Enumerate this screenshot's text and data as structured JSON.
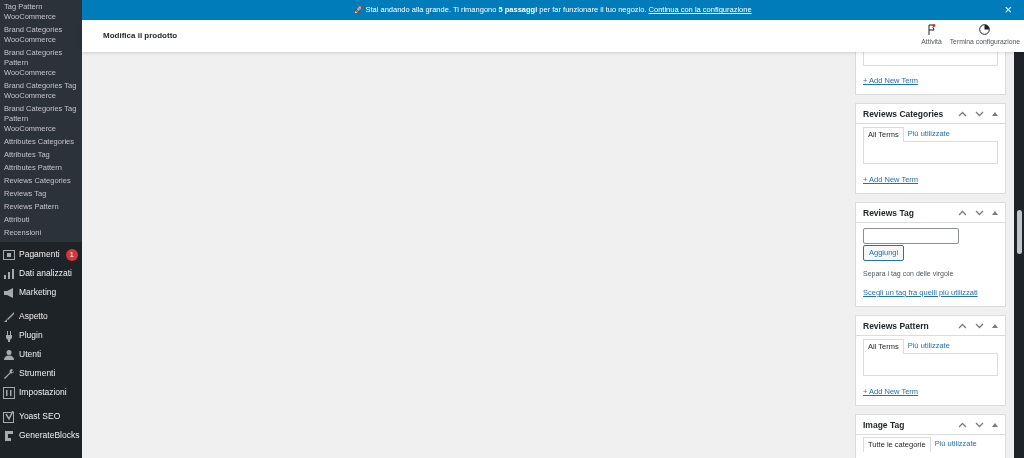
{
  "sidebar": {
    "submenu": [
      {
        "label": "Tag Pattern WooCommerce"
      },
      {
        "label": "Brand Categories WooCommerce"
      },
      {
        "label": "Brand Categories Pattern WooCommerce"
      },
      {
        "label": "Brand Categories Tag WooCommerce"
      },
      {
        "label": "Brand Categories Tag Pattern WooCommerce"
      },
      {
        "label": "Attributes Categories"
      },
      {
        "label": "Attributes Tag"
      },
      {
        "label": "Attributes Pattern"
      },
      {
        "label": "Reviews Categories"
      },
      {
        "label": "Reviews Tag"
      },
      {
        "label": "Reviews Pattern"
      },
      {
        "label": "Attributi"
      },
      {
        "label": "Recensioni"
      }
    ],
    "menu": [
      {
        "label": "Pagamenti",
        "badge": "1"
      },
      {
        "label": "Dati analizzati"
      },
      {
        "label": "Marketing"
      },
      {
        "label": "Aspetto"
      },
      {
        "label": "Plugin"
      },
      {
        "label": "Utenti"
      },
      {
        "label": "Strumenti"
      },
      {
        "label": "Impostazioni"
      },
      {
        "label": "Yoast SEO"
      },
      {
        "label": "GenerateBlocks"
      }
    ]
  },
  "notice": {
    "text": "🚀 Stai andando alla grande. Ti rimangono **5 passaggi** per far funzionare il tuo negozio.",
    "link": "Continua con la configurazione",
    "close": "×"
  },
  "header": {
    "title": "Modifica il prodotto",
    "actions": [
      {
        "label": "Attività"
      },
      {
        "label": "Termina configurazione"
      }
    ]
  },
  "boxes": [
    {
      "kind": "tail",
      "link": "+ Add New Term"
    },
    {
      "kind": "terms",
      "title": "Reviews Categories",
      "tabs": [
        {
          "label": "All Terms",
          "selected": true
        },
        {
          "label": "Più utilizzate",
          "selected": false
        }
      ],
      "link": "+ Add New Term"
    },
    {
      "kind": "tag",
      "title": "Reviews Tag",
      "button": "Aggiungi",
      "hint": "Separa i tag con delle virgole",
      "link": "Scegli un tag fra quelli più utilizzati"
    },
    {
      "kind": "terms",
      "title": "Reviews Pattern",
      "tabs": [
        {
          "label": "All Terms",
          "selected": true
        },
        {
          "label": "Più utilizzate",
          "selected": false
        }
      ],
      "link": "+ Add New Term"
    },
    {
      "kind": "head",
      "title": "Image Tag",
      "tabs": [
        {
          "label": "Tutte le categorie",
          "selected": true
        },
        {
          "label": "Più utilizzate",
          "selected": false
        }
      ]
    }
  ]
}
